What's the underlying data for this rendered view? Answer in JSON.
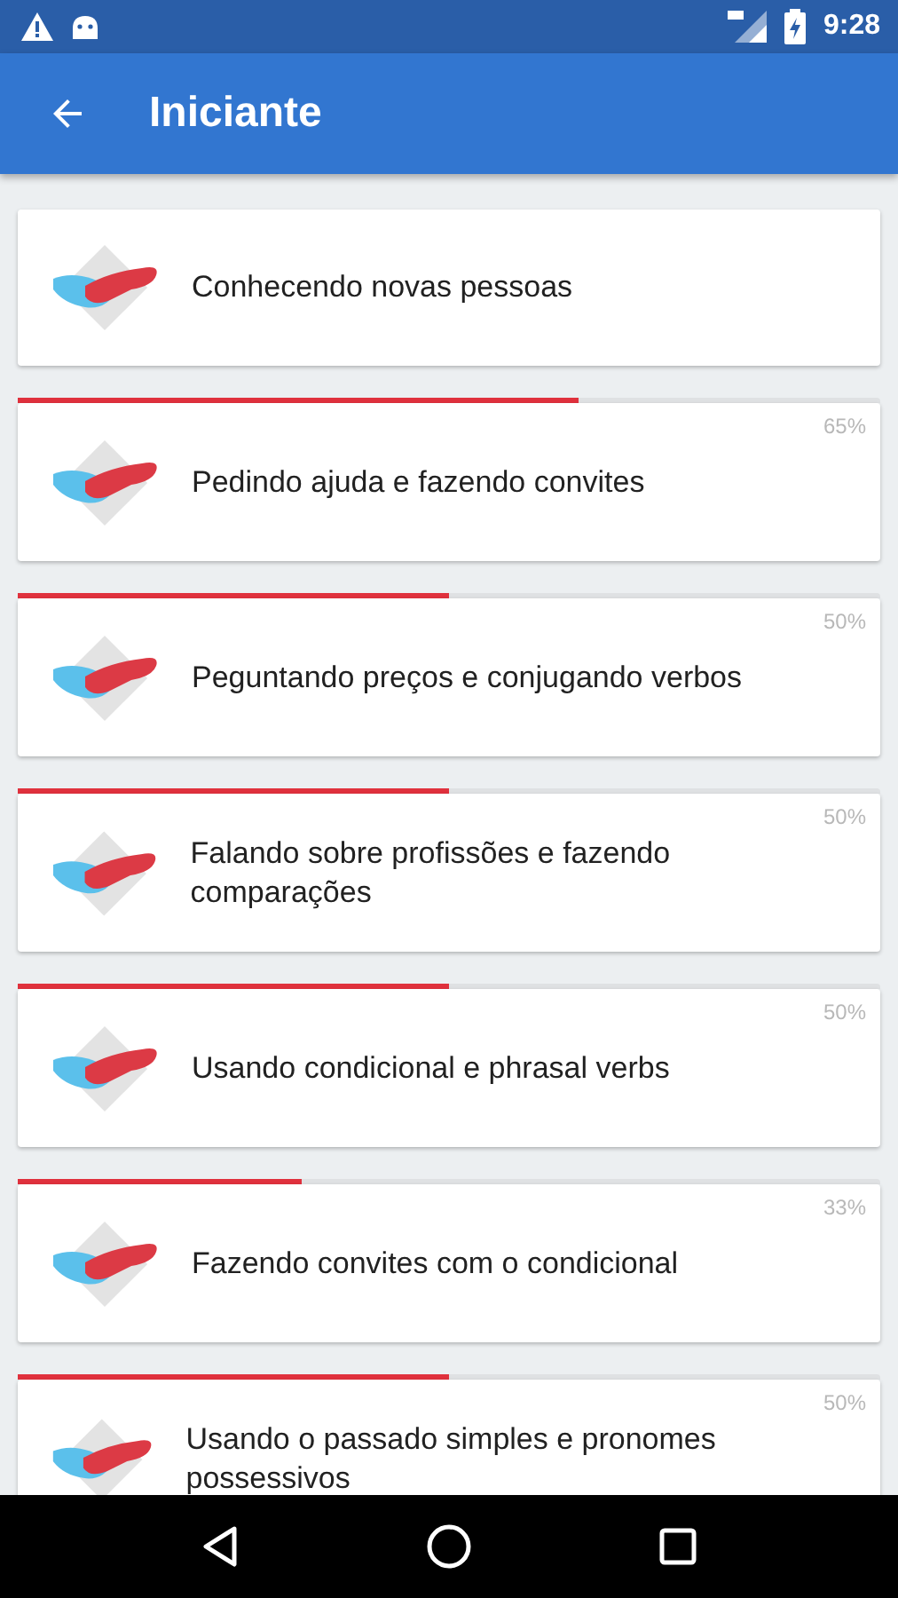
{
  "status_bar": {
    "time": "9:28"
  },
  "app_bar": {
    "title": "Iniciante"
  },
  "lessons": [
    {
      "title": "Conhecendo novas pessoas"
    },
    {
      "title": "Pedindo ajuda e fazendo convites",
      "level": 0.65,
      "percent": "65%"
    },
    {
      "title": "Peguntando preços e conjugando verbos",
      "level": 0.5,
      "percent": "50%"
    },
    {
      "title": "Falando sobre profissões e fazendo comparações",
      "level": 0.5,
      "percent": "50%"
    },
    {
      "title": "Usando condicional e phrasal verbs",
      "level": 0.5,
      "percent": "50%"
    },
    {
      "title": "Fazendo convites com o condicional",
      "level": 0.33,
      "percent": "33%"
    },
    {
      "title": "Usando o passado simples e pronomes possessivos",
      "level": 0.5,
      "percent": "50%"
    }
  ]
}
